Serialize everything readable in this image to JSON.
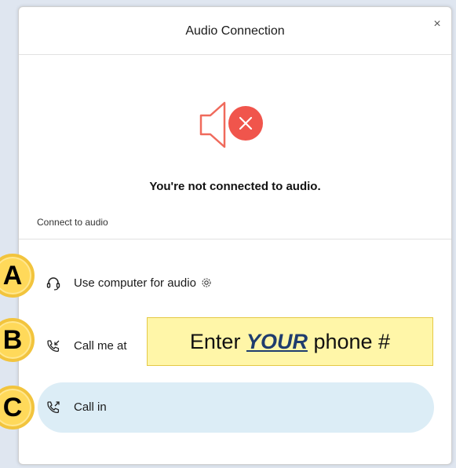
{
  "dialog": {
    "title": "Audio Connection",
    "close": "×",
    "status": "You're not connected to audio.",
    "section_label": "Connect to audio"
  },
  "options": {
    "computer": {
      "label": "Use computer for audio"
    },
    "call_me": {
      "label": "Call me at"
    },
    "call_in": {
      "label": "Call in"
    }
  },
  "annotations": {
    "badge_a": "A",
    "badge_b": "B",
    "badge_c": "C",
    "callout_prefix": "Enter ",
    "callout_emphasis": "YOUR",
    "callout_suffix": " phone #"
  },
  "colors": {
    "alert_red": "#f0554c",
    "speaker_red": "#f06a5c",
    "selected_bg": "#dcedf6",
    "badge_yellow": "#ffd95a",
    "callout_yellow": "#fff6a8"
  }
}
